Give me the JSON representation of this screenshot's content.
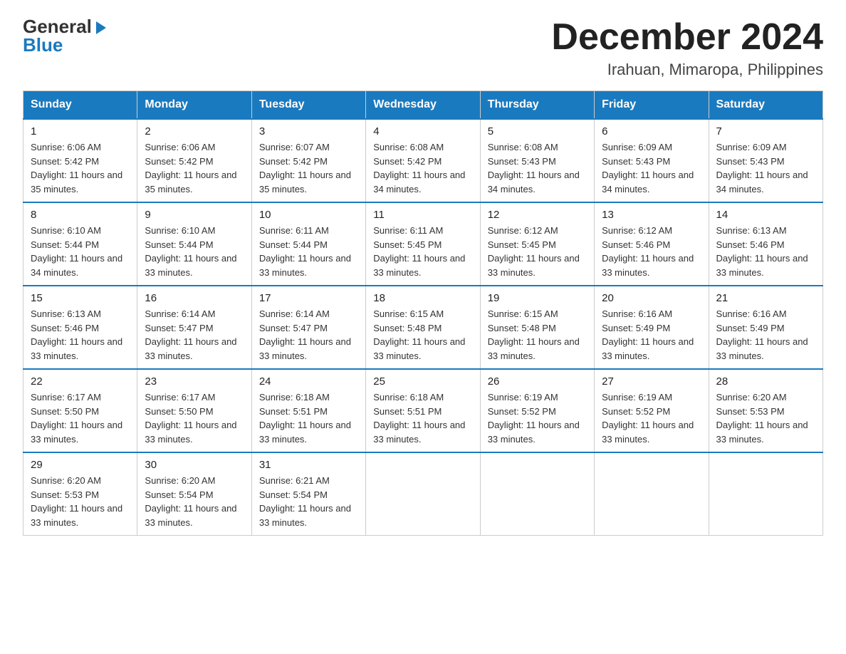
{
  "header": {
    "logo": {
      "general": "General",
      "blue": "Blue",
      "alt": "GeneralBlue logo"
    },
    "title": "December 2024",
    "location": "Irahuan, Mimaropa, Philippines"
  },
  "calendar": {
    "days_of_week": [
      "Sunday",
      "Monday",
      "Tuesday",
      "Wednesday",
      "Thursday",
      "Friday",
      "Saturday"
    ],
    "weeks": [
      [
        {
          "day": "1",
          "sunrise": "6:06 AM",
          "sunset": "5:42 PM",
          "daylight": "11 hours and 35 minutes."
        },
        {
          "day": "2",
          "sunrise": "6:06 AM",
          "sunset": "5:42 PM",
          "daylight": "11 hours and 35 minutes."
        },
        {
          "day": "3",
          "sunrise": "6:07 AM",
          "sunset": "5:42 PM",
          "daylight": "11 hours and 35 minutes."
        },
        {
          "day": "4",
          "sunrise": "6:08 AM",
          "sunset": "5:42 PM",
          "daylight": "11 hours and 34 minutes."
        },
        {
          "day": "5",
          "sunrise": "6:08 AM",
          "sunset": "5:43 PM",
          "daylight": "11 hours and 34 minutes."
        },
        {
          "day": "6",
          "sunrise": "6:09 AM",
          "sunset": "5:43 PM",
          "daylight": "11 hours and 34 minutes."
        },
        {
          "day": "7",
          "sunrise": "6:09 AM",
          "sunset": "5:43 PM",
          "daylight": "11 hours and 34 minutes."
        }
      ],
      [
        {
          "day": "8",
          "sunrise": "6:10 AM",
          "sunset": "5:44 PM",
          "daylight": "11 hours and 34 minutes."
        },
        {
          "day": "9",
          "sunrise": "6:10 AM",
          "sunset": "5:44 PM",
          "daylight": "11 hours and 33 minutes."
        },
        {
          "day": "10",
          "sunrise": "6:11 AM",
          "sunset": "5:44 PM",
          "daylight": "11 hours and 33 minutes."
        },
        {
          "day": "11",
          "sunrise": "6:11 AM",
          "sunset": "5:45 PM",
          "daylight": "11 hours and 33 minutes."
        },
        {
          "day": "12",
          "sunrise": "6:12 AM",
          "sunset": "5:45 PM",
          "daylight": "11 hours and 33 minutes."
        },
        {
          "day": "13",
          "sunrise": "6:12 AM",
          "sunset": "5:46 PM",
          "daylight": "11 hours and 33 minutes."
        },
        {
          "day": "14",
          "sunrise": "6:13 AM",
          "sunset": "5:46 PM",
          "daylight": "11 hours and 33 minutes."
        }
      ],
      [
        {
          "day": "15",
          "sunrise": "6:13 AM",
          "sunset": "5:46 PM",
          "daylight": "11 hours and 33 minutes."
        },
        {
          "day": "16",
          "sunrise": "6:14 AM",
          "sunset": "5:47 PM",
          "daylight": "11 hours and 33 minutes."
        },
        {
          "day": "17",
          "sunrise": "6:14 AM",
          "sunset": "5:47 PM",
          "daylight": "11 hours and 33 minutes."
        },
        {
          "day": "18",
          "sunrise": "6:15 AM",
          "sunset": "5:48 PM",
          "daylight": "11 hours and 33 minutes."
        },
        {
          "day": "19",
          "sunrise": "6:15 AM",
          "sunset": "5:48 PM",
          "daylight": "11 hours and 33 minutes."
        },
        {
          "day": "20",
          "sunrise": "6:16 AM",
          "sunset": "5:49 PM",
          "daylight": "11 hours and 33 minutes."
        },
        {
          "day": "21",
          "sunrise": "6:16 AM",
          "sunset": "5:49 PM",
          "daylight": "11 hours and 33 minutes."
        }
      ],
      [
        {
          "day": "22",
          "sunrise": "6:17 AM",
          "sunset": "5:50 PM",
          "daylight": "11 hours and 33 minutes."
        },
        {
          "day": "23",
          "sunrise": "6:17 AM",
          "sunset": "5:50 PM",
          "daylight": "11 hours and 33 minutes."
        },
        {
          "day": "24",
          "sunrise": "6:18 AM",
          "sunset": "5:51 PM",
          "daylight": "11 hours and 33 minutes."
        },
        {
          "day": "25",
          "sunrise": "6:18 AM",
          "sunset": "5:51 PM",
          "daylight": "11 hours and 33 minutes."
        },
        {
          "day": "26",
          "sunrise": "6:19 AM",
          "sunset": "5:52 PM",
          "daylight": "11 hours and 33 minutes."
        },
        {
          "day": "27",
          "sunrise": "6:19 AM",
          "sunset": "5:52 PM",
          "daylight": "11 hours and 33 minutes."
        },
        {
          "day": "28",
          "sunrise": "6:20 AM",
          "sunset": "5:53 PM",
          "daylight": "11 hours and 33 minutes."
        }
      ],
      [
        {
          "day": "29",
          "sunrise": "6:20 AM",
          "sunset": "5:53 PM",
          "daylight": "11 hours and 33 minutes."
        },
        {
          "day": "30",
          "sunrise": "6:20 AM",
          "sunset": "5:54 PM",
          "daylight": "11 hours and 33 minutes."
        },
        {
          "day": "31",
          "sunrise": "6:21 AM",
          "sunset": "5:54 PM",
          "daylight": "11 hours and 33 minutes."
        },
        null,
        null,
        null,
        null
      ]
    ]
  }
}
